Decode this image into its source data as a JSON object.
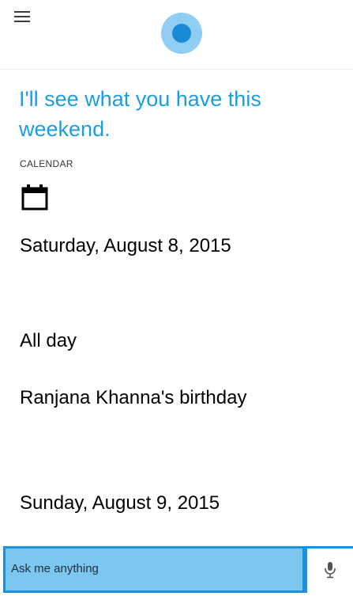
{
  "header": {
    "menu_icon": "hamburger-menu-icon",
    "logo_icon": "cortana-circle-icon"
  },
  "response": {
    "message": "I'll see what you have this weekend."
  },
  "calendar": {
    "section_label": "CALENDAR",
    "icon": "calendar-icon",
    "events": [
      {
        "date": "Saturday, August 8, 2015"
      },
      {
        "time": "All day"
      },
      {
        "title": "Ranjana Khanna's birthday"
      },
      {
        "date": "Sunday, August 9, 2015"
      }
    ]
  },
  "search": {
    "placeholder": "Ask me anything",
    "mic_icon": "microphone-icon"
  },
  "colors": {
    "accent": "#1a9ee0",
    "search_fill": "#7cc7ef",
    "search_border": "#1f8fd7",
    "logo_outer": "#8fcdf2",
    "logo_inner": "#1a8ad6"
  }
}
